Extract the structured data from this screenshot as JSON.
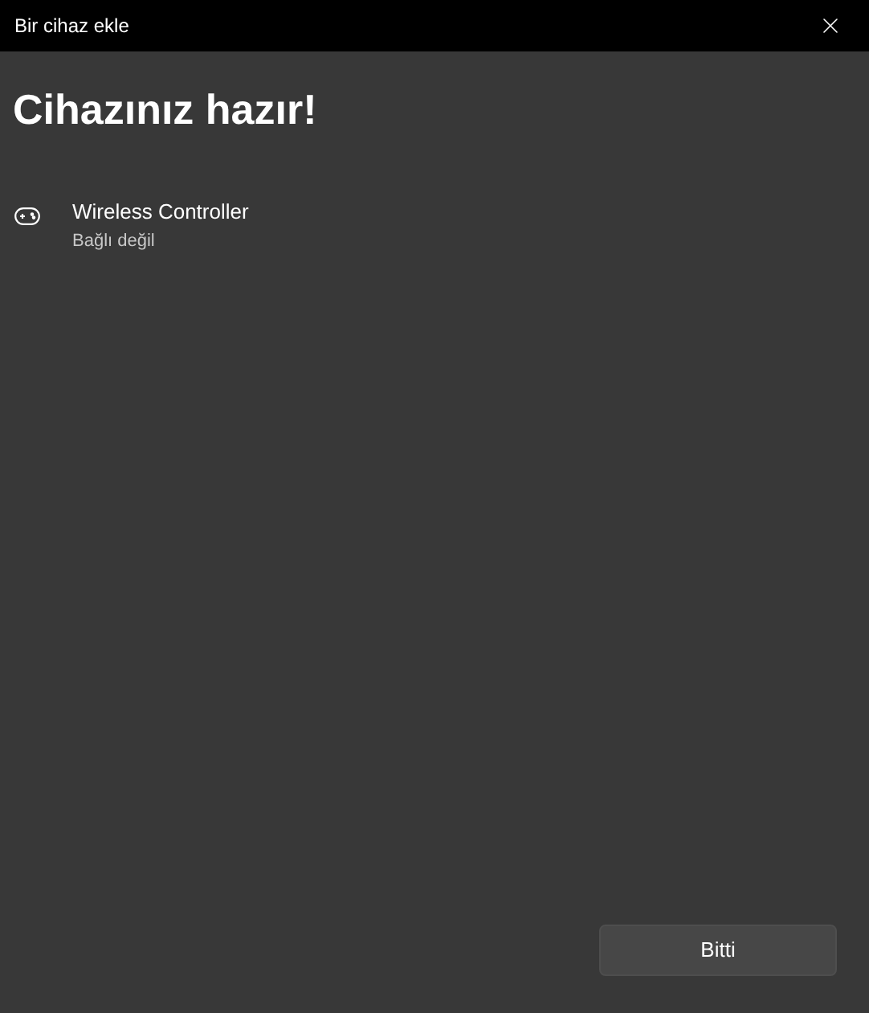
{
  "window": {
    "title": "Bir cihaz ekle"
  },
  "heading": "Cihazınız hazır!",
  "devices": [
    {
      "name": "Wireless Controller",
      "status": "Bağlı değil"
    }
  ],
  "buttons": [
    "Bitti"
  ]
}
